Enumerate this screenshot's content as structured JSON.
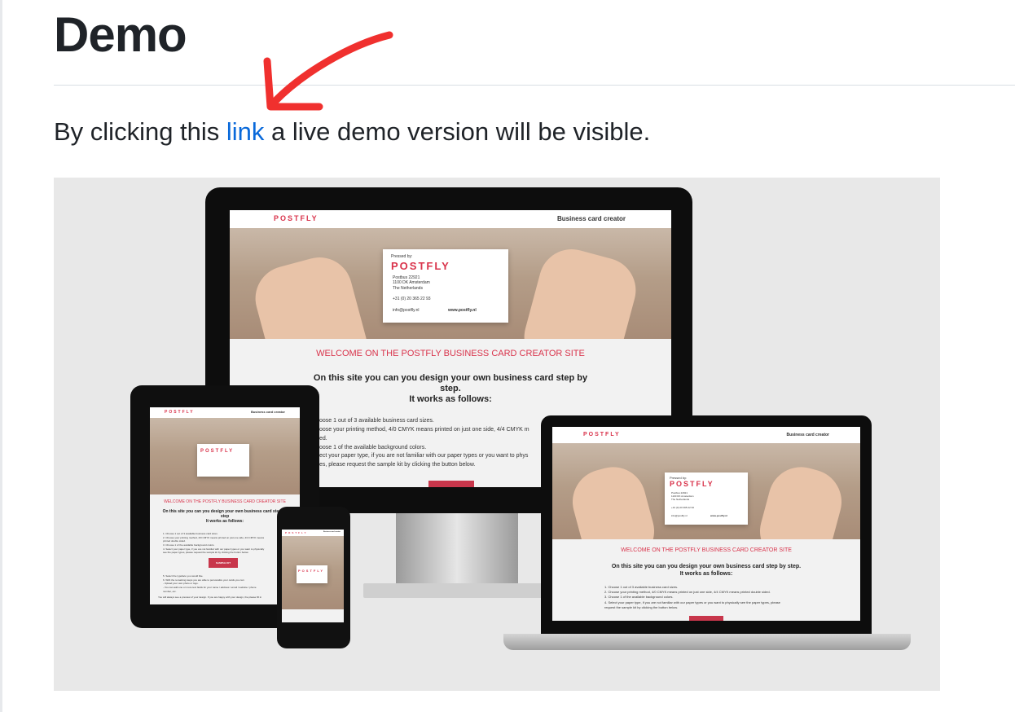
{
  "page": {
    "title": "Demo",
    "intro_before": "By clicking this ",
    "intro_link": "link",
    "intro_after": " a live demo version will be visible."
  },
  "colors": {
    "link": "#0969da",
    "arrow": "#f0302e",
    "brand": "#d9334b"
  },
  "site": {
    "logo": "POSTFLY",
    "header_right": "Business card creator",
    "card_pressed_by": "Pressed by:",
    "card_address": "Postbus 22921\n1100 DK Amsterdam\nThe Netherlands",
    "card_phone": "+31 (0) 20 365 22 93",
    "card_email": "info@postfly.nl",
    "card_web": "www.postfly.nl",
    "welcome": "WELCOME ON THE POSTFLY BUSINESS CARD CREATOR SITE",
    "desc_line1": "On this site you can you design your own business card step by step.",
    "desc_line2": "It works as follows:",
    "desc_desktop": "On this site you can you design your own business card step by\nstep.\nIt works as follows:",
    "desc_tablet": "On this site you can you design your own business card step by\nstep\nIt works as follows:",
    "steps_desktop": "oose 1 out of 3 available business card sizes.\noose your printing method, 4/0 CMYK means printed on just one side, 4/4 CMYK m\ned.\noose 1 of the available background colors.\nect your paper type, if you are not familiar with our paper types or you want to phys\nes, please request the sample kit by clicking the button below.",
    "steps_laptop": "1. Choose 1 out of 3 available business card sizes.\n2. Choose your printing method, 4/0 CMYK means printed on just one side, 4/4 CMYK means printed double sided.\n3. Choose 1 of the available background colors.\n4. Select your paper type, if you are not familiar with our paper types or you want to physically see the paper types, please\n   request the sample kit by clicking the button below.",
    "steps_tablet": "1. Choose 1 out of 3 available business card sizes.\n2. Choose your printing method, 4/0 CMYK means printed on just one side, 4/4 CMYK means\n   printed double sided.\n3. Choose 1 of the available background colors.\n4. Select your paper type, if you are not familiar with our paper types or you want to physically\n   see the paper types, please request the sample kit by clicking the button below.",
    "sample_kit": "SAMPLE KIT",
    "steps_tablet_2": "5. Select the typeface you would like.\n6. With the remaining steps you are able to personalize your cards you can:\n   - Upload your own photo or logo.\n   - You can add one or more text fields for your name / address / email / website / phone\n     number, etc.",
    "footer_tablet": "You will always see a preview of your design. If you are happy with your design, the please fill in"
  }
}
